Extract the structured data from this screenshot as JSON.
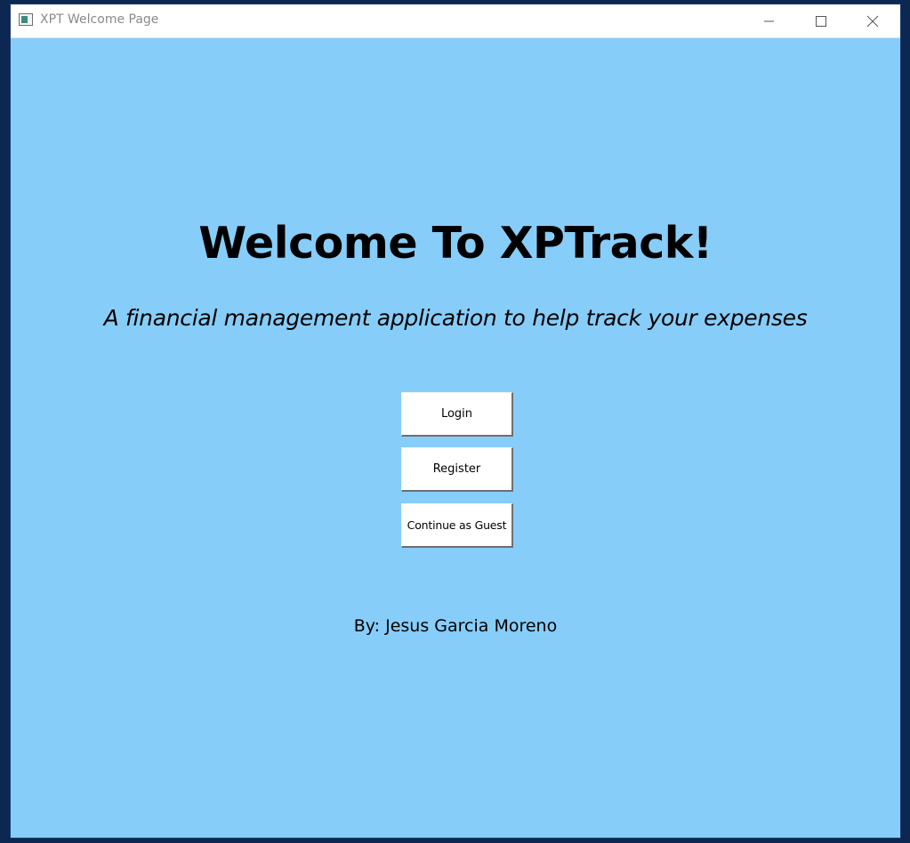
{
  "window": {
    "title": "XPT Welcome Page",
    "controls": {
      "minimize_icon": "minimize-icon",
      "maximize_icon": "maximize-icon",
      "close_icon": "close-icon"
    }
  },
  "main": {
    "heading": "Welcome To XPTrack!",
    "subheading": "A financial management application to help track your expenses",
    "buttons": {
      "login": "Login",
      "register": "Register",
      "guest": "Continue as Guest"
    },
    "byline": "By: Jesus Garcia Moreno"
  },
  "colors": {
    "background": "#87cdf9",
    "button": "#ffffff",
    "titlebar": "#ffffff"
  }
}
